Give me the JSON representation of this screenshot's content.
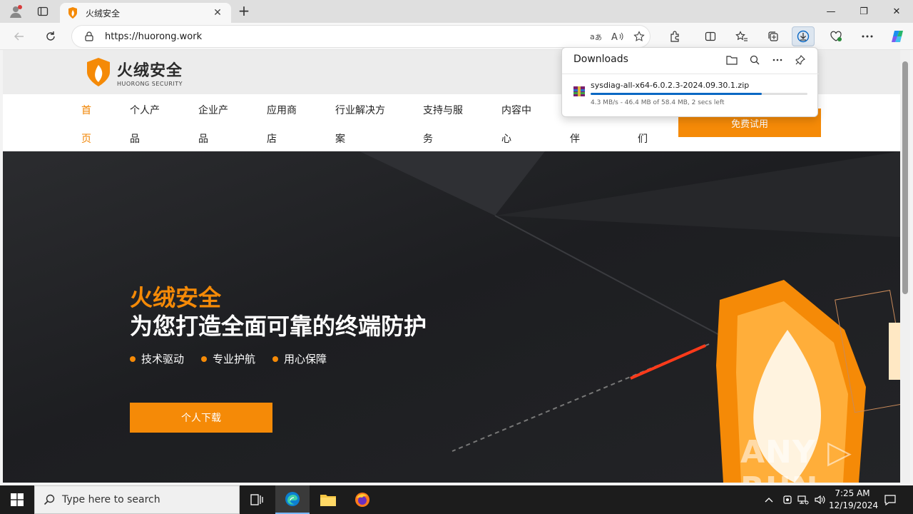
{
  "browser": {
    "tab_title": "火绒安全",
    "url": "https://huorong.work",
    "new_tab_label": "+",
    "close_label": "✕",
    "window_controls": {
      "minimize": "—",
      "maximize": "❐",
      "close": "✕"
    }
  },
  "downloads": {
    "title": "Downloads",
    "file_name": "sysdiag-all-x64-6.0.2.3-2024.09.30.1.zip",
    "status": "4.3 MB/s - 46.4 MB of 58.4 MB, 2 secs left",
    "progress_fraction": 0.79
  },
  "site": {
    "logo_cn": "火绒安全",
    "logo_en": "HUORONG SECURITY",
    "nav": [
      {
        "l1": "首",
        "l2": "页"
      },
      {
        "l1": "个人产",
        "l2": "品"
      },
      {
        "l1": "企业产",
        "l2": "品"
      },
      {
        "l1": "应用商",
        "l2": "店"
      },
      {
        "l1": "行业解决方",
        "l2": "案"
      },
      {
        "l1": "支持与服",
        "l2": "务"
      },
      {
        "l1": "内容中",
        "l2": "心"
      },
      {
        "l1": "",
        "l2": "伴"
      },
      {
        "l1": "",
        "l2": "们"
      }
    ],
    "free_trial": "免费试用",
    "hero": {
      "title_1": "火绒安全",
      "title_2": "为您打造全面可靠的终端防护",
      "features": [
        "技术驱动",
        "专业护航",
        "用心保障"
      ],
      "download_label": "个人下载"
    },
    "watermark": "ANY ▷ RUN"
  },
  "taskbar": {
    "search_placeholder": "Type here to search",
    "time": "7:25 AM",
    "date": "12/19/2024"
  },
  "colors": {
    "accent": "#f58a07",
    "edge_blue": "#0a68c4"
  }
}
